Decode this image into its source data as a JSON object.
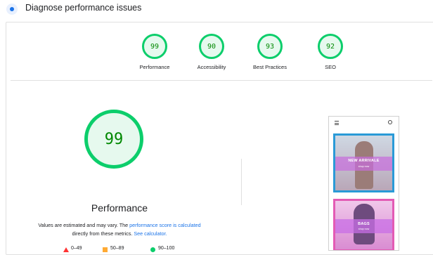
{
  "header": {
    "title": "Diagnose performance issues",
    "icon": "lighthouse-icon"
  },
  "gauges": [
    {
      "label": "Performance",
      "score": "99"
    },
    {
      "label": "Accessibility",
      "score": "90"
    },
    {
      "label": "Best Practices",
      "score": "93"
    },
    {
      "label": "SEO",
      "score": "92"
    }
  ],
  "main": {
    "score": "99",
    "title": "Performance",
    "note_prefix": "Values are estimated and may vary. The ",
    "note_link1": "performance score is calculated",
    "note_middle": " directly from these metrics. ",
    "note_link2": "See calculator."
  },
  "legend": {
    "fail": "0–49",
    "average": "50–89",
    "pass": "90–100"
  },
  "screenshot": {
    "tile1_caption": "NEW ARRIVALE",
    "tile1_sub": "shop now",
    "tile2_caption": "BAGS",
    "tile2_sub": "shop now"
  },
  "colors": {
    "pass": "#0cce6b",
    "pass_text": "#008800",
    "link": "#1a73e8"
  }
}
